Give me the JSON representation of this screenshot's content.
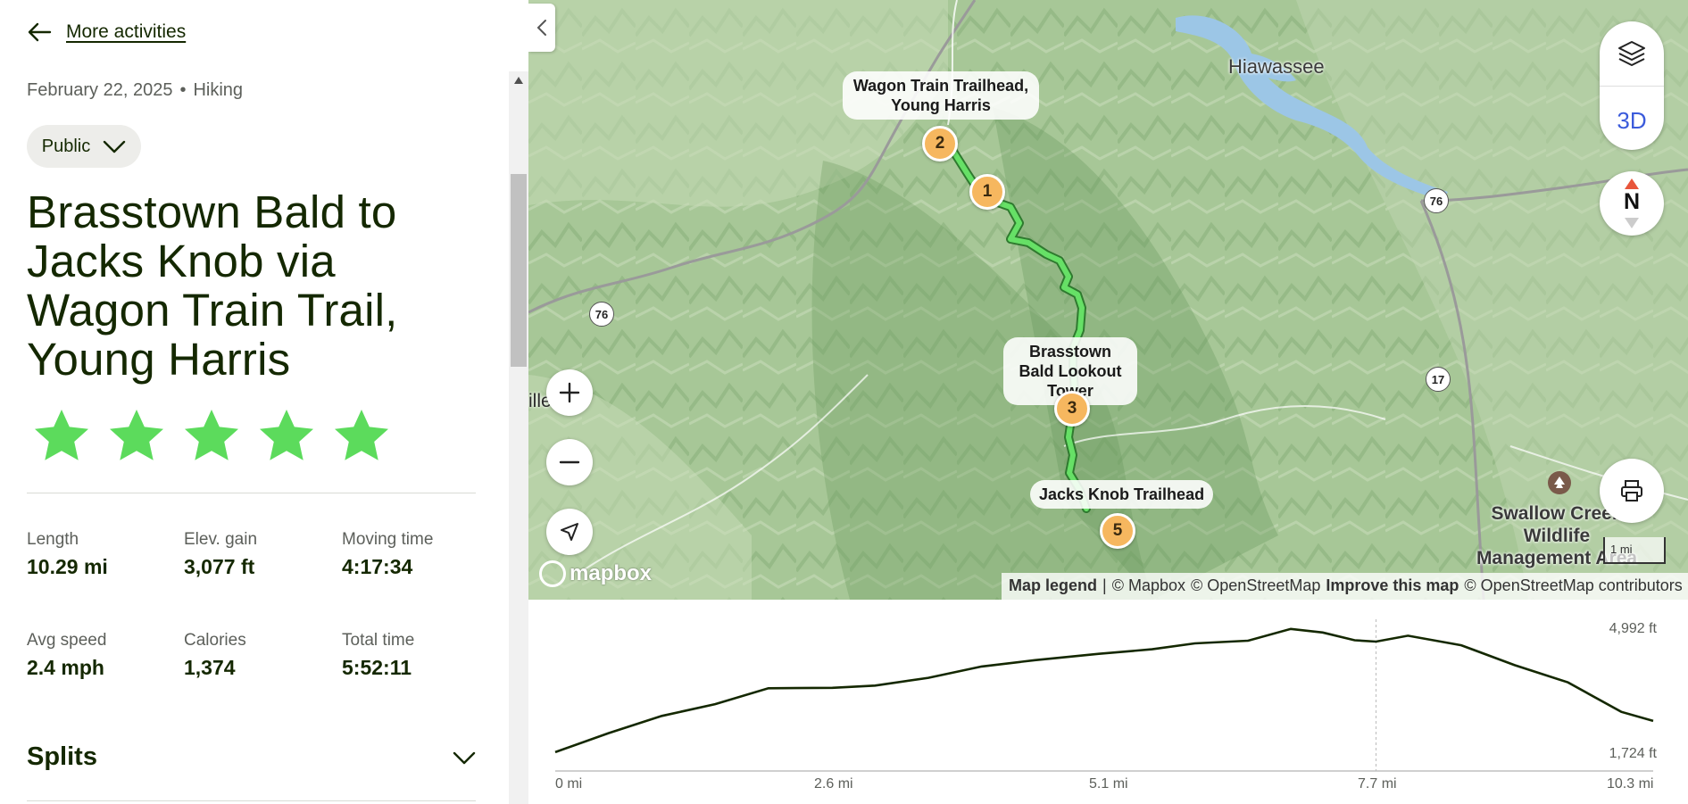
{
  "nav": {
    "back_label": "More activities"
  },
  "activity": {
    "date": "February 22, 2025",
    "separator": "•",
    "type": "Hiking",
    "visibility": "Public",
    "title": "Brasstown Bald to Jacks Knob via Wagon Train Trail, Young Harris",
    "rating": 5,
    "star_color": "#5cdb5c"
  },
  "stats": [
    {
      "label": "Length",
      "value": "10.29 mi"
    },
    {
      "label": "Elev. gain",
      "value": "3,077 ft"
    },
    {
      "label": "Moving time",
      "value": "4:17:34"
    },
    {
      "label": "Avg speed",
      "value": "2.4 mph"
    },
    {
      "label": "Calories",
      "value": "1,374"
    },
    {
      "label": "Total time",
      "value": "5:52:11"
    }
  ],
  "splits": {
    "label": "Splits"
  },
  "map": {
    "controls": {
      "three_d_label": "3D",
      "north_label": "N"
    },
    "waypoints": [
      {
        "number": "2",
        "label": "Wagon Train Trailhead, Young Harris"
      },
      {
        "number": "1",
        "label": ""
      },
      {
        "number": "3",
        "label": "Brasstown Bald Lookout Tower"
      },
      {
        "number": "5",
        "label": "Jacks Knob Trailhead"
      }
    ],
    "places": {
      "hiawassee": "Hiawassee",
      "ille": "ille",
      "swallow": "Swallow Creek Wildlife Management Area"
    },
    "shields": {
      "us76_a": "76",
      "us76_b": "76",
      "ga17": "17"
    },
    "logo": "mapbox",
    "scale": "1 mi",
    "attribution": {
      "legend": "Map legend",
      "sep": "|",
      "mapbox": "© Mapbox",
      "osm": "© OpenStreetMap",
      "improve": "Improve this map",
      "osm_contrib": "© OpenStreetMap contributors"
    },
    "route_color": "#66e066"
  },
  "elevation": {
    "y_max_label": "4,992 ft",
    "y_min_label": "1,724 ft",
    "x_labels": [
      "0 mi",
      "2.6 mi",
      "5.1 mi",
      "7.7 mi",
      "10.3 mi"
    ],
    "marker_mi_label": "7.7 mi"
  },
  "chart_data": {
    "type": "line",
    "title": "",
    "xlabel": "",
    "ylabel": "",
    "xlim": [
      0,
      10.3
    ],
    "ylim": [
      1724,
      4992
    ],
    "x_unit": "mi",
    "y_unit": "ft",
    "series": [
      {
        "x": [
          0,
          0.5,
          1.0,
          1.5,
          2.0,
          2.6,
          3.0,
          3.5,
          4.0,
          4.5,
          5.1,
          5.6,
          6.0,
          6.5,
          6.9,
          7.2,
          7.5,
          7.7,
          8.0,
          8.5,
          9.0,
          9.5,
          10.0,
          10.3
        ],
        "y": [
          2060,
          2480,
          2860,
          3120,
          3470,
          3480,
          3530,
          3700,
          3950,
          4090,
          4230,
          4330,
          4460,
          4520,
          4780,
          4700,
          4530,
          4500,
          4630,
          4420,
          3980,
          3600,
          2950,
          2750
        ]
      }
    ]
  }
}
